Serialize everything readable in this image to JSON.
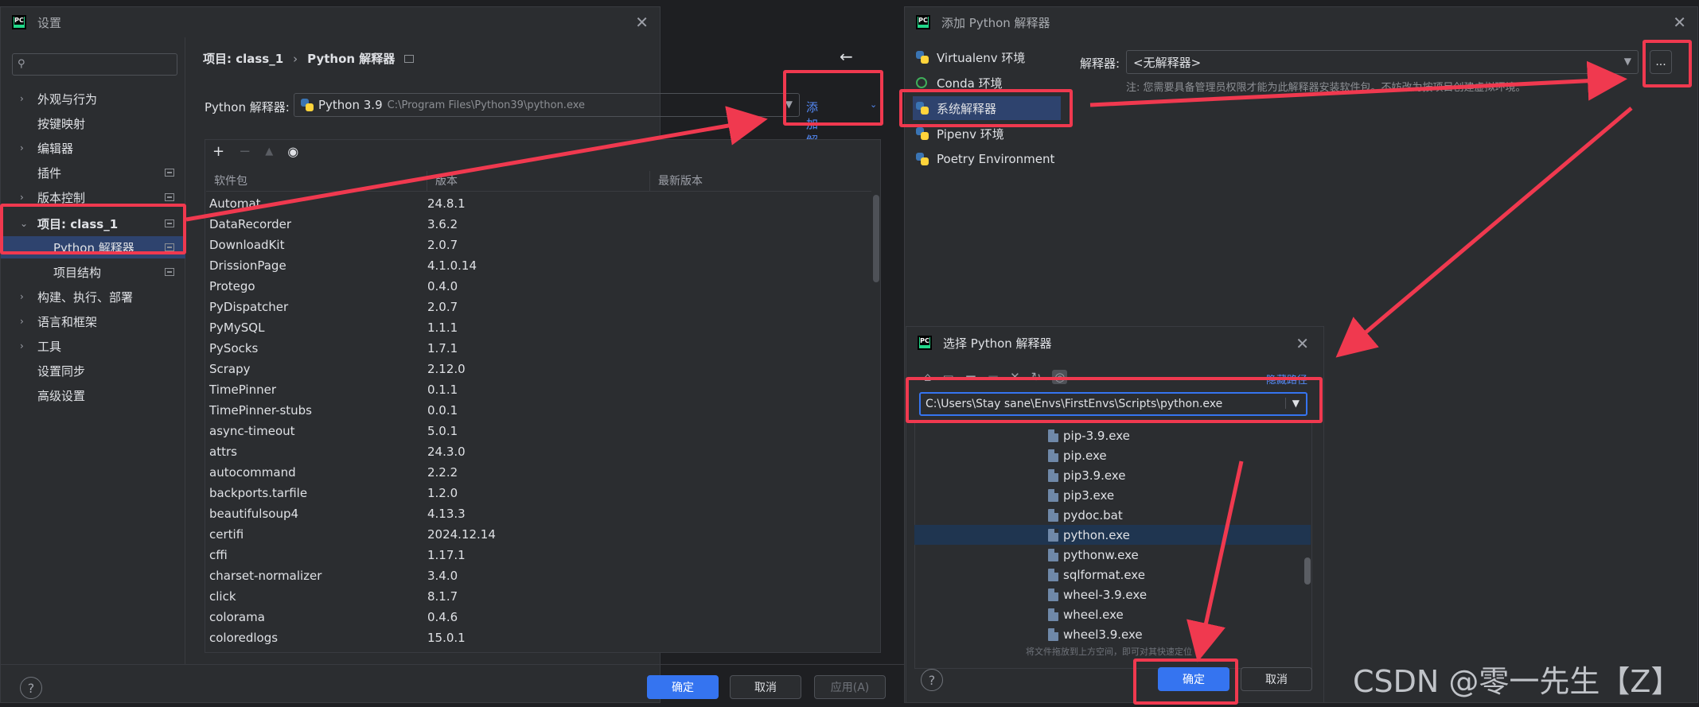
{
  "settings": {
    "title": "设置",
    "breadcrumb": {
      "project": "项目: class_1",
      "separator": "›",
      "page": "Python 解释器"
    },
    "nav": [
      {
        "label": "外观与行为",
        "chevron": "›",
        "gear": false
      },
      {
        "label": "按键映射",
        "chevron": "",
        "gear": false
      },
      {
        "label": "编辑器",
        "chevron": "›",
        "gear": false
      },
      {
        "label": "插件",
        "chevron": "",
        "gear": true
      },
      {
        "label": "版本控制",
        "chevron": "›",
        "gear": true
      },
      {
        "label": "项目: class_1",
        "chevron": "⌄",
        "gear": true
      },
      {
        "label": "Python 解释器",
        "chevron": "",
        "gear": true
      },
      {
        "label": "项目结构",
        "chevron": "",
        "gear": true
      },
      {
        "label": "构建、执行、部署",
        "chevron": "›",
        "gear": false
      },
      {
        "label": "语言和框架",
        "chevron": "›",
        "gear": false
      },
      {
        "label": "工具",
        "chevron": "›",
        "gear": false
      },
      {
        "label": "设置同步",
        "chevron": "",
        "gear": false
      },
      {
        "label": "高级设置",
        "chevron": "",
        "gear": false
      }
    ],
    "interpreter_label": "Python 解释器:",
    "interpreter_name": "Python 3.9",
    "interpreter_path": "C:\\Program Files\\Python39\\python.exe",
    "add_interpreter": "添加解释器",
    "table_headers": [
      "软件包",
      "版本",
      "最新版本"
    ],
    "packages": [
      [
        "Automat",
        "24.8.1"
      ],
      [
        "DataRecorder",
        "3.6.2"
      ],
      [
        "DownloadKit",
        "2.0.7"
      ],
      [
        "DrissionPage",
        "4.1.0.14"
      ],
      [
        "Protego",
        "0.4.0"
      ],
      [
        "PyDispatcher",
        "2.0.7"
      ],
      [
        "PyMySQL",
        "1.1.1"
      ],
      [
        "PySocks",
        "1.7.1"
      ],
      [
        "Scrapy",
        "2.12.0"
      ],
      [
        "TimePinner",
        "0.1.1"
      ],
      [
        "TimePinner-stubs",
        "0.0.1"
      ],
      [
        "async-timeout",
        "5.0.1"
      ],
      [
        "attrs",
        "24.3.0"
      ],
      [
        "autocommand",
        "2.2.2"
      ],
      [
        "backports.tarfile",
        "1.2.0"
      ],
      [
        "beautifulsoup4",
        "4.13.3"
      ],
      [
        "certifi",
        "2024.12.14"
      ],
      [
        "cffi",
        "1.17.1"
      ],
      [
        "charset-normalizer",
        "3.4.0"
      ],
      [
        "click",
        "8.1.7"
      ],
      [
        "colorama",
        "0.4.6"
      ],
      [
        "coloredlogs",
        "15.0.1"
      ]
    ],
    "buttons": {
      "ok": "确定",
      "cancel": "取消",
      "apply": "应用(A)",
      "help": "?"
    }
  },
  "add_interpreter": {
    "title": "添加 Python 解释器",
    "envs": [
      "Virtualenv 环境",
      "Conda 环境",
      "系统解释器",
      "Pipenv 环境",
      "Poetry Environment"
    ],
    "interpreter_label": "解释器:",
    "interpreter_value": "<无解释器>",
    "browse": "...",
    "note": "注: 您需要具备管理员权限才能为此解释器安装软件包。不妨改为按项目创建虚拟环境。"
  },
  "select_interpreter": {
    "title": "选择 Python 解释器",
    "hide_path": "隐藏路径",
    "path": "C:\\Users\\Stay sane\\Envs\\FirstEnvs\\Scripts\\python.exe",
    "files": [
      "pip-3.9.exe",
      "pip.exe",
      "pip3.9.exe",
      "pip3.exe",
      "pydoc.bat",
      "python.exe",
      "pythonw.exe",
      "sqlformat.exe",
      "wheel-3.9.exe",
      "wheel.exe",
      "wheel3.9.exe"
    ],
    "hint": "将文件拖放到上方空间，即可对其快速定位",
    "ok": "确定",
    "cancel": "取消",
    "help": "?"
  },
  "watermark": "CSDN @零一先生【Z】",
  "colors": {
    "accent": "#3574f0",
    "selection": "#2e436e",
    "highlight": "#f0394f",
    "bg": "#2b2d30"
  }
}
